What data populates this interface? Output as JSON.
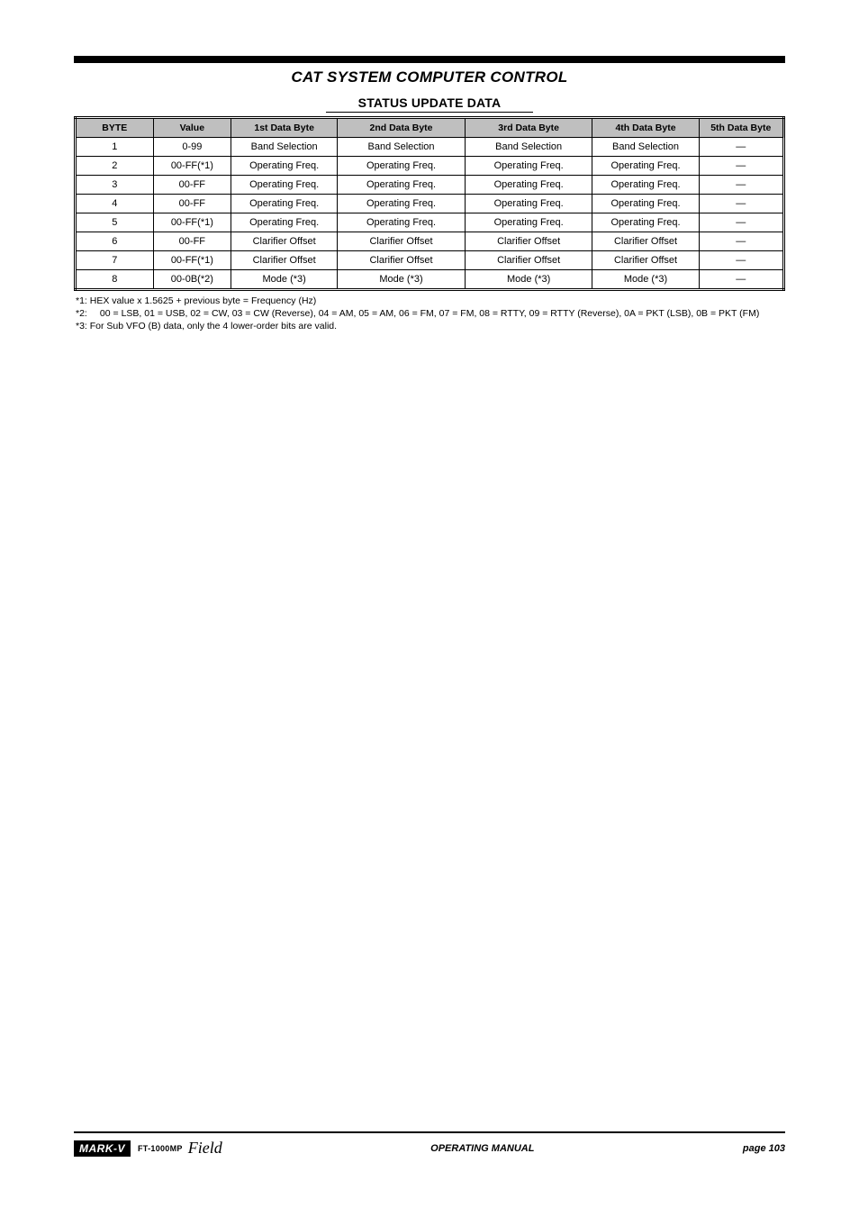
{
  "chapter_title": "CAT SYSTEM COMPUTER CONTROL",
  "table_title": "STATUS UPDATE DATA",
  "table": {
    "headers": [
      "BYTE",
      "Value",
      "1st Data Byte",
      "2nd Data Byte",
      "3rd Data Byte",
      "4th Data Byte",
      "5th Data Byte"
    ],
    "rows": [
      [
        "1",
        "0-99",
        "Band Selection",
        "Band Selection",
        "Band Selection",
        "Band Selection",
        "—"
      ],
      [
        "2",
        "00-FF(*1)",
        "Operating Freq.",
        "Operating Freq.",
        "Operating Freq.",
        "Operating Freq.",
        "—"
      ],
      [
        "3",
        "00-FF",
        "Operating Freq.",
        "Operating Freq.",
        "Operating Freq.",
        "Operating Freq.",
        "—"
      ],
      [
        "4",
        "00-FF",
        "Operating Freq.",
        "Operating Freq.",
        "Operating Freq.",
        "Operating Freq.",
        "—"
      ],
      [
        "5",
        "00-FF(*1)",
        "Operating Freq.",
        "Operating Freq.",
        "Operating Freq.",
        "Operating Freq.",
        "—"
      ],
      [
        "6",
        "00-FF",
        "Clarifier Offset",
        "Clarifier Offset",
        "Clarifier Offset",
        "Clarifier Offset",
        "—"
      ],
      [
        "7",
        "00-FF(*1)",
        "Clarifier Offset",
        "Clarifier Offset",
        "Clarifier Offset",
        "Clarifier Offset",
        "—"
      ],
      [
        "8",
        "00-0B(*2)",
        "Mode (*3)",
        "Mode (*3)",
        "Mode (*3)",
        "Mode (*3)",
        "—"
      ]
    ]
  },
  "notes": {
    "n1": "*1: HEX value x 1.5625 + previous byte = Frequency (Hz)",
    "n2_prefix": "*2:",
    "n2_items": [
      "00 = LSB",
      "01 = USB",
      "02 = CW",
      "03 = CW (Reverse)",
      "04 = AM",
      "05 = AM",
      "06 = FM",
      "07 = FM",
      "08 = RTTY",
      "09 = RTTY (Reverse)",
      "0A = PKT (LSB)",
      "0B = PKT (FM)"
    ],
    "n3": "*3: For Sub VFO (B) data, only the 4 lower-order bits are valid."
  },
  "footer": {
    "brand_markv": "MARK-V",
    "brand_ft": "FT-1000MP",
    "brand_field": "Field",
    "manual_label": "OPERATING MANUAL",
    "page": "page 103"
  }
}
